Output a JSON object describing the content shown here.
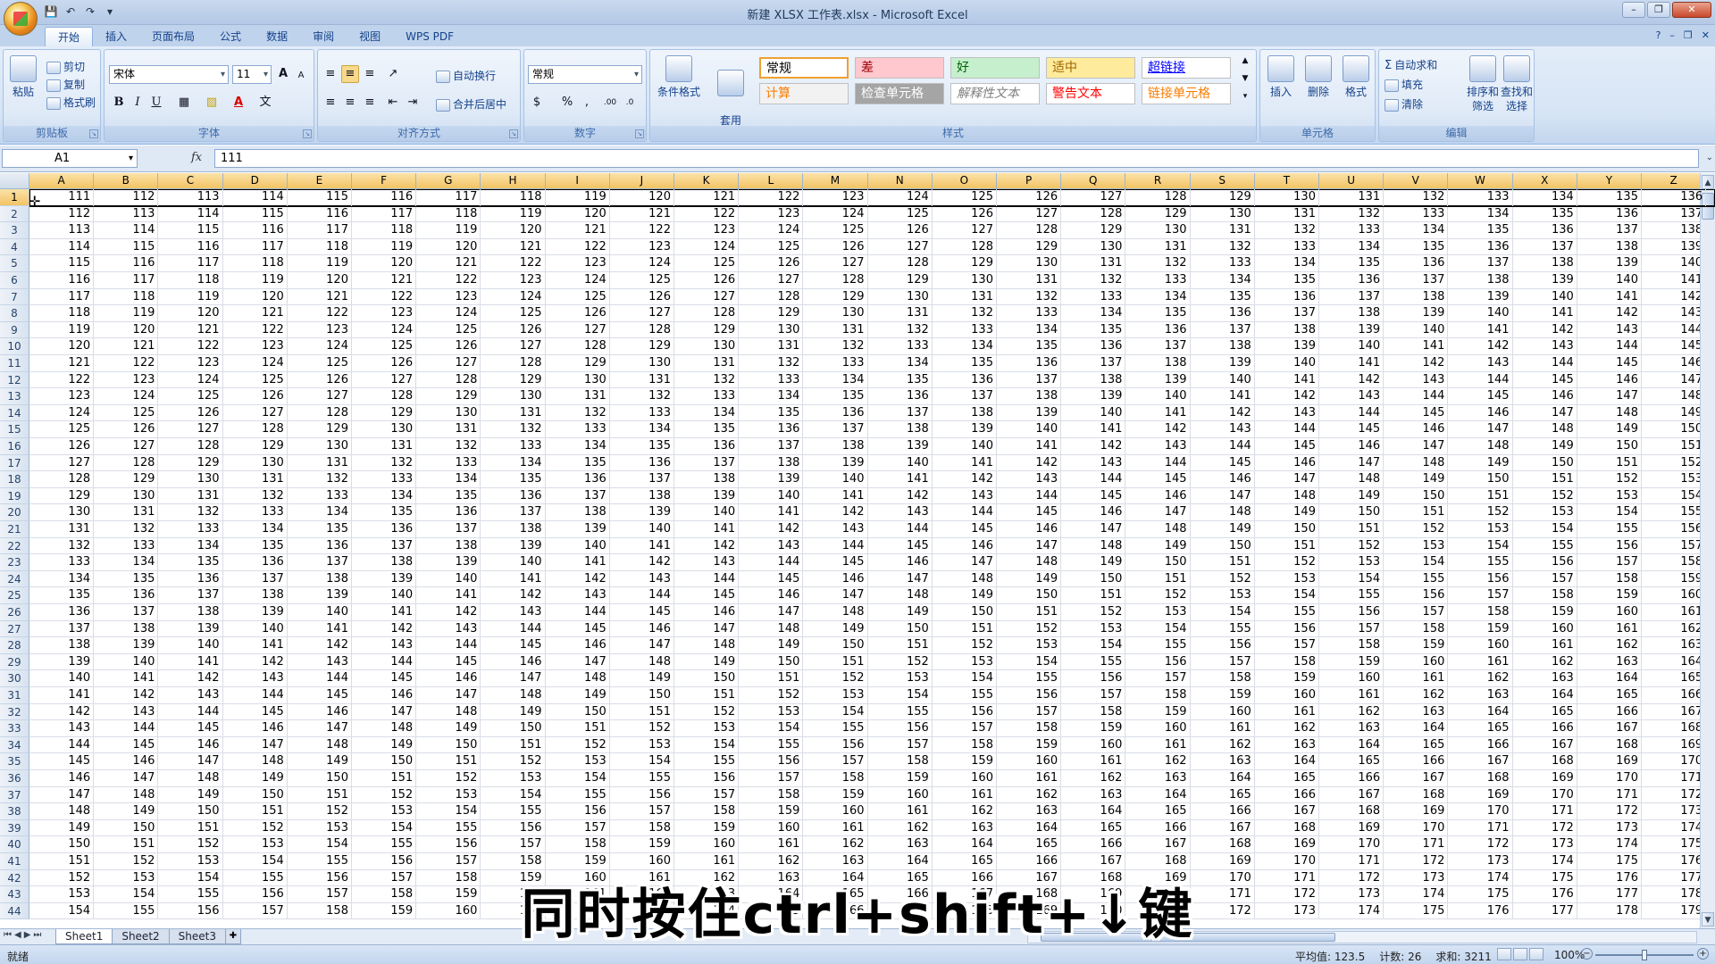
{
  "window": {
    "title": "新建 XLSX 工作表.xlsx - Microsoft Excel",
    "minimize": "–",
    "restore": "❐",
    "close": "✕"
  },
  "qat": [
    "💾",
    "↶",
    "↷",
    "▾"
  ],
  "tabs": [
    {
      "label": "开始",
      "active": true
    },
    {
      "label": "插入"
    },
    {
      "label": "页面布局"
    },
    {
      "label": "公式"
    },
    {
      "label": "数据"
    },
    {
      "label": "审阅"
    },
    {
      "label": "视图"
    },
    {
      "label": "WPS PDF"
    }
  ],
  "ribbon_right": [
    "?",
    "–",
    "❐",
    "✕"
  ],
  "clipboard": {
    "label": "剪贴板",
    "paste": "粘贴",
    "cut": "剪切",
    "copy": "复制",
    "format_painter": "格式刷"
  },
  "font": {
    "label": "字体",
    "name": "宋体",
    "size": "11",
    "grow": "A",
    "shrink": "A",
    "bold": "B",
    "italic": "I",
    "underline": "U",
    "border": "▦",
    "fill": "▨",
    "color": "A",
    "wen": "文"
  },
  "alignment": {
    "label": "对齐方式",
    "wrap": "自动换行",
    "merge": "合并后居中"
  },
  "number": {
    "label": "数字",
    "format": "常规",
    "percent": "%",
    "comma": ",",
    "inc": ".00",
    "dec": ".0"
  },
  "styles": {
    "label": "样式",
    "conditional": "条件格式",
    "table": "套用\n表格格式",
    "cells": [
      {
        "text": "常规",
        "bg": "#ffffff",
        "fg": "#000000",
        "border": "#f0a030"
      },
      {
        "text": "差",
        "bg": "#ffc7ce",
        "fg": "#9c0006"
      },
      {
        "text": "好",
        "bg": "#c6efce",
        "fg": "#006100"
      },
      {
        "text": "适中",
        "bg": "#ffeb9c",
        "fg": "#9c6500"
      },
      {
        "text": "超链接",
        "bg": "#ffffff",
        "fg": "#0000ff",
        "underline": true
      },
      {
        "text": "计算",
        "bg": "#f2f2f2",
        "fg": "#fa7d00"
      },
      {
        "text": "检查单元格",
        "bg": "#a5a5a5",
        "fg": "#ffffff"
      },
      {
        "text": "解释性文本",
        "bg": "#ffffff",
        "fg": "#7f7f7f",
        "italic": true
      },
      {
        "text": "警告文本",
        "bg": "#ffffff",
        "fg": "#ff0000"
      },
      {
        "text": "链接单元格",
        "bg": "#ffffff",
        "fg": "#fa7d00"
      }
    ]
  },
  "cells_group": {
    "label": "单元格",
    "insert": "插入",
    "delete": "删除",
    "format": "格式"
  },
  "editing": {
    "label": "编辑",
    "autosum": "自动求和",
    "fill": "填充",
    "clear": "清除",
    "sort": "排序和\n筛选",
    "find": "查找和\n选择"
  },
  "formula_bar": {
    "name_box": "A1",
    "fx": "fx",
    "value": "111"
  },
  "grid": {
    "columns": [
      "A",
      "B",
      "C",
      "D",
      "E",
      "F",
      "G",
      "H",
      "I",
      "J",
      "K",
      "L",
      "M",
      "N",
      "O",
      "P",
      "Q",
      "R",
      "S",
      "T",
      "U",
      "V",
      "W",
      "X",
      "Y",
      "Z"
    ],
    "first_row": 1,
    "row_count": 44,
    "start_value": 111,
    "selected_row": 1
  },
  "caption": "同时按住ctrl+shift+↓键",
  "sheets": [
    {
      "name": "Sheet1",
      "active": true
    },
    {
      "name": "Sheet2"
    },
    {
      "name": "Sheet3"
    }
  ],
  "status": {
    "ready": "就绪",
    "average": "平均值: 123.5",
    "count": "计数: 26",
    "sum": "求和: 3211",
    "zoom": "100%"
  }
}
